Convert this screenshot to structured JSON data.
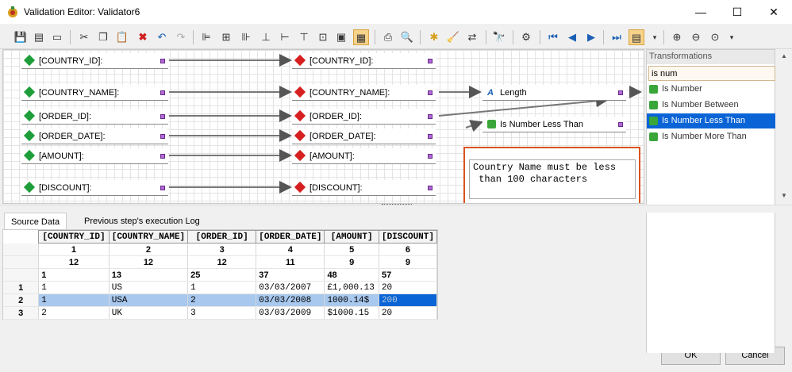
{
  "window": {
    "title": "Validation Editor: Validator6",
    "minimize": "—",
    "maximize": "☐",
    "close": "✕"
  },
  "toolbar_icons": [
    "save-icon",
    "properties-icon",
    "print-setup-icon",
    "cut-icon",
    "copy-icon",
    "paste-icon",
    "delete-icon",
    "undo-icon",
    "redo-icon",
    "align-left-icon",
    "align-center-icon",
    "align-right-icon",
    "align-bottom-icon",
    "align-middle-icon",
    "align-top-icon",
    "same-size-icon",
    "group-icon",
    "print-icon",
    "print-preview-icon",
    "new-icon",
    "clean-icon",
    "auto-layout-icon",
    "find-icon",
    "execute-icon",
    "first-icon",
    "prev-icon",
    "next-icon",
    "last-icon",
    "toggle-panel-icon",
    "zoom-in-icon",
    "zoom-out-icon",
    "zoom-fit-icon"
  ],
  "source_nodes": [
    "[COUNTRY_ID]:",
    "[COUNTRY_NAME]:",
    "[ORDER_ID]:",
    "[ORDER_DATE]:",
    "[AMOUNT]:",
    "[DISCOUNT]:"
  ],
  "target_nodes": [
    "[COUNTRY_ID]:",
    "[COUNTRY_NAME]:",
    "[ORDER_ID]:",
    "[ORDER_DATE]:",
    "[AMOUNT]:",
    "[DISCOUNT]:"
  ],
  "transform_nodes": {
    "length": "Length",
    "is_number_less_than": "Is Number Less Than"
  },
  "note_text": "Country Name must be less\n than 100 characters",
  "transformations": {
    "header": "Transformations",
    "search": "is num",
    "items": [
      "Is Number",
      "Is Number Between",
      "Is Number Less Than",
      "Is Number More Than"
    ],
    "selected": "Is Number Less Than"
  },
  "tabs": [
    "Source Data",
    "Previous step's execution Log"
  ],
  "grid": {
    "columns": [
      "[COUNTRY_ID]",
      "[COUNTRY_NAME]",
      "[ORDER_ID]",
      "[ORDER_DATE]",
      "[AMOUNT]",
      "[DISCOUNT]"
    ],
    "col_index": [
      "1",
      "2",
      "3",
      "4",
      "5",
      "6"
    ],
    "col_width": [
      "12",
      "12",
      "12",
      "11",
      "9",
      "9"
    ],
    "col_pos": [
      "1",
      "13",
      "25",
      "37",
      "48",
      "57"
    ],
    "rows": [
      {
        "num": "1",
        "cells": [
          "1",
          "US",
          "1",
          "03/03/2007",
          "£1,000.13",
          "20"
        ]
      },
      {
        "num": "2",
        "cells": [
          "1",
          "USA",
          "2",
          "03/03/2008",
          "1000.14$",
          "200"
        ]
      },
      {
        "num": "3",
        "cells": [
          "2",
          "UK",
          "3",
          "03/03/2009",
          "$1000.15",
          "20"
        ]
      }
    ],
    "selected_row": "2"
  },
  "buttons": {
    "ok": "OK",
    "cancel": "Cancel"
  }
}
